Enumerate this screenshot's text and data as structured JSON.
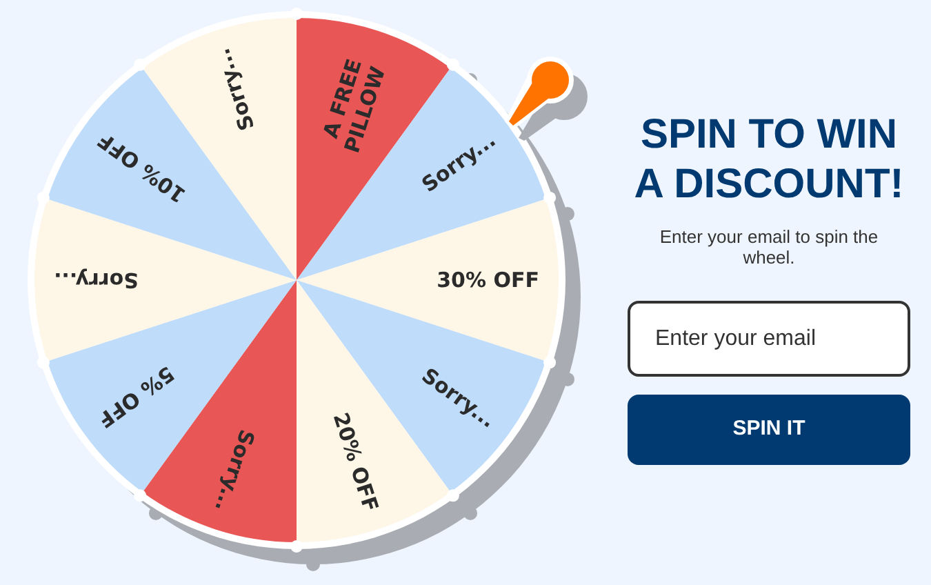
{
  "wheel": {
    "segments": [
      {
        "label": "A FREE PILLOW",
        "color": "#e85656"
      },
      {
        "label": "Sorry...",
        "color": "#bfdcfb"
      },
      {
        "label": "30% OFF",
        "color": "#fef6e6"
      },
      {
        "label": "Sorry...",
        "color": "#bfdcfb"
      },
      {
        "label": "20% OFF",
        "color": "#fef6e6"
      },
      {
        "label": "Sorry...",
        "color": "#e85656"
      },
      {
        "label": "5% OFF",
        "color": "#bfdcfb"
      },
      {
        "label": "Sorry...",
        "color": "#fef6e6"
      },
      {
        "label": "10% OFF",
        "color": "#bfdcfb"
      },
      {
        "label": "Sorry...",
        "color": "#fef6e6"
      }
    ]
  },
  "panel": {
    "heading": "SPIN TO WIN A DISCOUNT!",
    "subtitle": "Enter your email to spin the wheel.",
    "email": {
      "placeholder": "Enter your email"
    },
    "button": "SPIN IT"
  }
}
